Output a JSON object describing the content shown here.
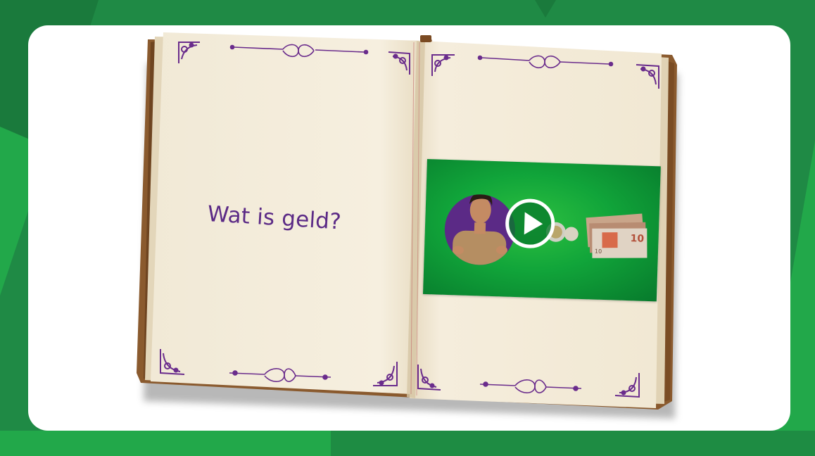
{
  "book": {
    "left_page": {
      "title": "Wat is geld?"
    },
    "right_page": {
      "video": {
        "thumbnail": "man-with-money-thumbnail",
        "play_icon": "play-icon"
      }
    }
  },
  "colors": {
    "background_green": "#1f8a45",
    "panel": "#ffffff",
    "title_purple": "#5b2a86",
    "ornament_purple": "#6a2c8c",
    "video_green": "#11a53a"
  },
  "icons": [
    "corner-ornament-icon",
    "flourish-divider-icon",
    "play-icon"
  ]
}
